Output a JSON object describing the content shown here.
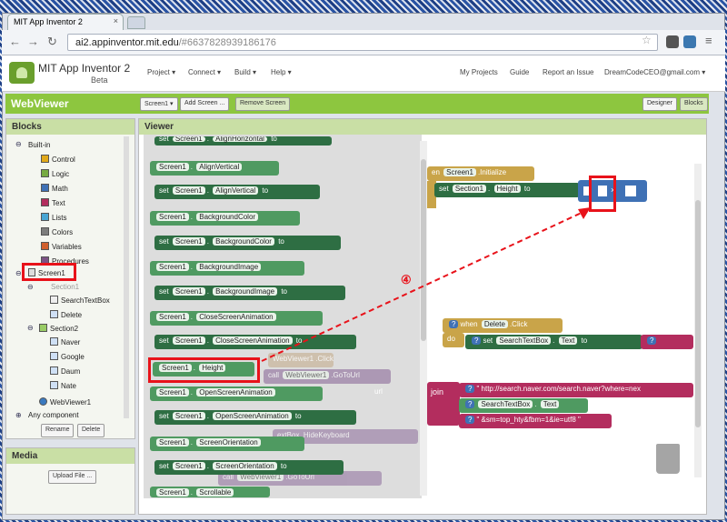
{
  "browser": {
    "tab_title": "MIT App Inventor 2",
    "url_host": "ai2.appinventor.mit.edu",
    "url_hash": "/#6637828939186176"
  },
  "app": {
    "name": "MIT App Inventor 2",
    "beta": "Beta",
    "menus": [
      "Project ▾",
      "Connect ▾",
      "Build ▾",
      "Help ▾"
    ],
    "right_links": [
      "My Projects",
      "Guide",
      "Report an Issue",
      "DreamCodeCEO@gmail.com ▾"
    ]
  },
  "toolbar": {
    "screen_title": "WebViewer",
    "screen_select": "Screen1 ▾",
    "add_screen": "Add Screen ...",
    "remove_screen": "Remove Screen",
    "designer": "Designer",
    "blocks": "Blocks"
  },
  "blocks_panel": {
    "title": "Blocks",
    "builtin": "Built-in",
    "builtin_items": [
      {
        "label": "Control",
        "color": "#e1a91a"
      },
      {
        "label": "Logic",
        "color": "#77ab41"
      },
      {
        "label": "Math",
        "color": "#3f71b5"
      },
      {
        "label": "Text",
        "color": "#b32d5e"
      },
      {
        "label": "Lists",
        "color": "#49a6d4"
      },
      {
        "label": "Colors",
        "color": "#7d7d7d"
      },
      {
        "label": "Variables",
        "color": "#d05f2d"
      },
      {
        "label": "Procedures",
        "color": "#7c5385"
      }
    ],
    "screen": "Screen1",
    "section1": "Section1",
    "section1_items": [
      "SearchTextBox",
      "Delete"
    ],
    "section2": "Section2",
    "section2_items": [
      "Naver",
      "Google",
      "Daum",
      "Nate"
    ],
    "webviewer": "WebViewer1",
    "any_component": "Any component",
    "rename": "Rename",
    "delete": "Delete"
  },
  "media": {
    "title": "Media",
    "upload": "Upload File ..."
  },
  "viewer": {
    "title": "Viewer",
    "flyout": {
      "screen": "Screen1",
      "set": "set",
      "to": "to",
      "props": [
        "AlignVertical",
        "AlignVertical",
        "BackgroundColor",
        "BackgroundColor",
        "BackgroundImage",
        "BackgroundImage",
        "CloseScreenAnimation",
        "CloseScreenAnimation",
        "Height",
        "OpenScreenAnimation",
        "OpenScreenAnimation",
        "ScreenOrientation",
        "ScreenOrientation",
        "Scrollable"
      ],
      "top_partial": "AlignHorizontal"
    },
    "ghost": {
      "webviewer": "WebViewer1",
      "click": ".Click",
      "call": "call",
      "gotourl": ".GoToUrl",
      "url": "url",
      "textbox": "extBox",
      "hide_keyboard": ".HideKeyboard"
    },
    "workspace": {
      "initialize_when": "en",
      "initialize_screen": "Screen1",
      "initialize_event": ".Initialize",
      "set": "set",
      "section1": "Section1",
      "height": "Height",
      "to": "to",
      "times": "×",
      "when": "when",
      "delete": "Delete",
      "click": ".Click",
      "do": "do",
      "searchtextbox": "SearchTextBox",
      "text": "Text",
      "dot": ".",
      "join": "join",
      "url_text": "\" http://search.naver.com/search.naver?where=nex",
      "url_suffix": "\" &sm=top_hty&fbm=1&ie=utf8 \""
    },
    "step_label": "④"
  }
}
